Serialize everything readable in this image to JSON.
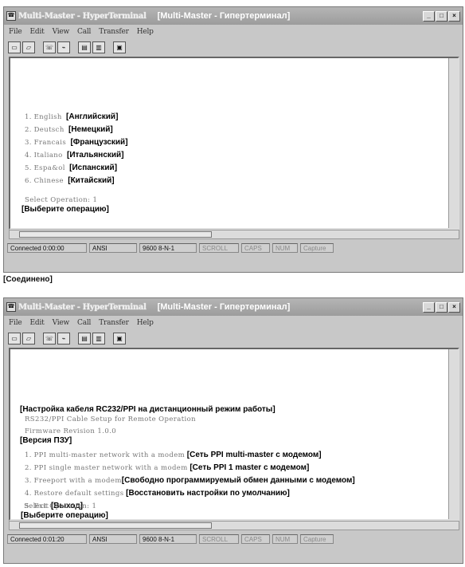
{
  "window1": {
    "title_blur": "Multi-Master - HyperTerminal",
    "title_ru": "[Multi-Master - Гипертерминал]",
    "menu": [
      "File",
      "Edit",
      "View",
      "Call",
      "Transfer",
      "Help"
    ],
    "lines": [
      {
        "num": "1.",
        "blur": "English",
        "ru": "[Английский]"
      },
      {
        "num": "2.",
        "blur": "Deutsch",
        "ru": "[Немецкий]"
      },
      {
        "num": "3.",
        "blur": "Francais",
        "ru": "[Французский]"
      },
      {
        "num": "4.",
        "blur": "Italiano",
        "ru": "[Итальянский]"
      },
      {
        "num": "5.",
        "blur": "Espa&ol",
        "ru": "[Испанский]"
      },
      {
        "num": "6.",
        "blur": "Chinese",
        "ru": "[Китайский]"
      }
    ],
    "select_blur": "Select Operation: 1",
    "select_ru": "[Выберите операцию]",
    "status": [
      "Connected 0:00:00",
      "ANSI",
      "9600 8-N-1",
      "SCROLL",
      "CAPS",
      "NUM",
      "Capture"
    ],
    "connected_ru": "[Соединено]"
  },
  "window2": {
    "title_blur": "Multi-Master - HyperTerminal",
    "title_ru": "[Multi-Master - Гипертерминал]",
    "menu": [
      "File",
      "Edit",
      "View",
      "Call",
      "Transfer",
      "Help"
    ],
    "header_ru": "[Настройка кабеля RC232/PPI на дистанционный режим работы]",
    "header_blur": "RS232/PPI Cable Setup for Remote Operation",
    "firmware_blur": "Firmware Revision 1.0.0",
    "firmware_ru": "[Версия ПЗУ]",
    "lines": [
      {
        "num": "1.",
        "blur": "PPI multi-master network with a modem",
        "ru": "[Сеть PPI multi-master с модемом]"
      },
      {
        "num": "2.",
        "blur": "PPI single master network with a modem",
        "ru": "[Сеть PPI 1 master с модемом]"
      },
      {
        "num": "3.",
        "blur": "Freeport with a modem",
        "ru": "[Свободно программируемый обмен данными с модемом]"
      },
      {
        "num": "4.",
        "blur": "Restore default settings",
        "ru": "[Восстановить настройки по умолчанию]"
      },
      {
        "num": "5.",
        "blur": "Exit",
        "ru": "[Выход]"
      }
    ],
    "select_blur": "Select Operation: 1",
    "select_ru": "[Выберите операцию]",
    "status": [
      "Connected 0:01:20",
      "ANSI",
      "9600 8-N-1",
      "SCROLL",
      "CAPS",
      "NUM",
      "Capture"
    ]
  }
}
